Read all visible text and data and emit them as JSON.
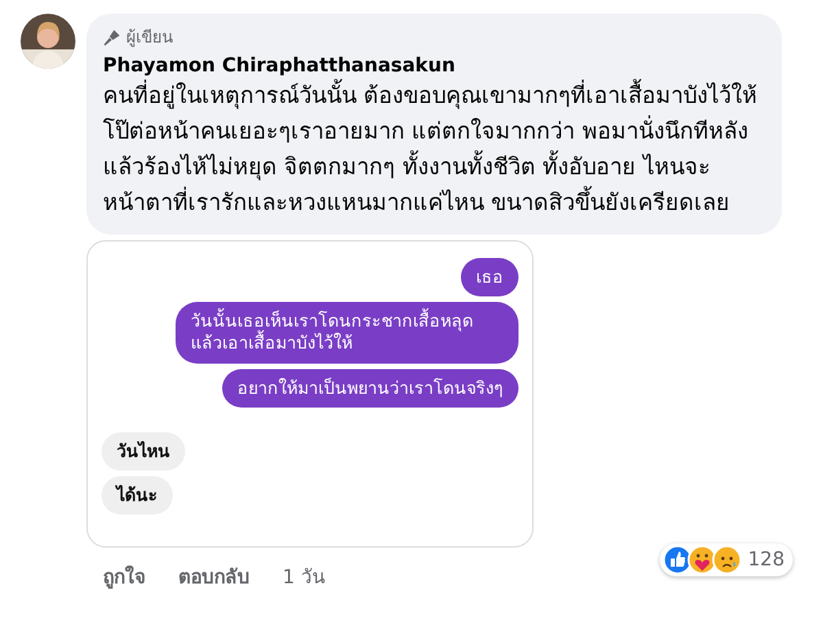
{
  "comment": {
    "badge": "ผู้เขียน",
    "author": "Phayamon Chiraphatthanasakun",
    "text": "คนที่อยู่ในเหตุการณ์วันนั้น ต้องขอบคุณเขามากๆที่เอาเสื้อมาบังไว้ให้ โป๊ต่อหน้าคนเยอะๆเราอายมาก แต่ตกใจมากกว่า พอมานั่งนึกทีหลังแล้วร้องไห้ไม่หยุด จิตตกมากๆ ทั้งงานทั้งชีวิต ทั้งอับอาย ไหนจะหน้าตาที่เรารักและหวงแหนมากแค่ไหน ขนาดสิวขึ้นยังเครียดเลย"
  },
  "attachment": {
    "messages": [
      {
        "kind": "outgoing",
        "text": "เธอ"
      },
      {
        "kind": "outgoing",
        "text": "วันนั้นเธอเห็นเราโดนกระชากเสื้อหลุดแล้วเอาเสื้อมาบังไว้ให้"
      },
      {
        "kind": "outgoing",
        "text": "อยากให้มาเป็นพยานว่าเราโดนจริงๆ"
      },
      {
        "kind": "incoming",
        "text": "วันไหน"
      },
      {
        "kind": "incoming",
        "text": "ได้นะ"
      }
    ]
  },
  "actions": [
    "ถูกใจ",
    "ตอบกลับ",
    "1 วัน"
  ],
  "reactions": {
    "count": "128"
  }
}
